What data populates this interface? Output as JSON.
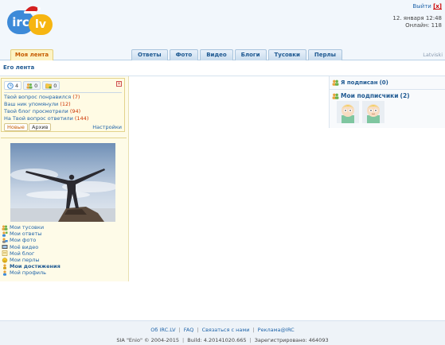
{
  "colors": {
    "brand_blue": "#3d8ad8",
    "brand_orange": "#f6b511",
    "link": "#2266aa",
    "count": "#cc3300",
    "active_tab": "#c65b00"
  },
  "header": {
    "logo_left": "irc",
    "logo_right": "lv",
    "logout_label": "Выйти",
    "logout_x": "[x]",
    "datetime": "12. января 12:48",
    "online": "Онлайн: 118"
  },
  "nav": {
    "my_feed": "Моя лента",
    "tabs": [
      "Ответы",
      "Фото",
      "Видео",
      "Блоги",
      "Тусовки",
      "Перлы"
    ],
    "language": "Latviski"
  },
  "feed": {
    "heading": "Его лента"
  },
  "notifications": {
    "counters": [
      {
        "icon": "clock-icon",
        "value": "4"
      },
      {
        "icon": "users-icon",
        "value": "0"
      },
      {
        "icon": "folder-icon",
        "value": "0"
      }
    ],
    "close": "✕",
    "items": [
      {
        "label": "Твой вопрос понравился",
        "count": "(7)"
      },
      {
        "label": "Ваш ник упомянули",
        "count": "(12)"
      },
      {
        "label": "Твой блог просмотрели",
        "count": "(94)"
      },
      {
        "label": "На Твой вопрос ответили",
        "count": "(144)"
      }
    ],
    "new_label": "Новые",
    "archive_label": "Архив",
    "settings_label": "Настройки"
  },
  "profile_menu": [
    {
      "icon": "group-icon",
      "label": "Мои тусовки"
    },
    {
      "icon": "answers-icon",
      "label": "Мои ответы"
    },
    {
      "icon": "photo-icon",
      "label": "Мои фото"
    },
    {
      "icon": "video-icon",
      "label": "Моё видео"
    },
    {
      "icon": "blog-icon",
      "label": "Мой блог"
    },
    {
      "icon": "smile-icon",
      "label": "Мои перлы"
    },
    {
      "icon": "achievement-icon",
      "label": "Мои достижения"
    },
    {
      "icon": "profile-icon",
      "label": "Мой профиль"
    }
  ],
  "right": {
    "subscribed_label": "Я подписан",
    "subscribed_count": "(0)",
    "followers_label": "Мои подписчики",
    "followers_count": "(2)"
  },
  "footer": {
    "links": [
      "Об IRC.LV",
      "FAQ",
      "Связаться с нами",
      "Реклама@IRC"
    ],
    "copyright": "SIA \"Enio\" © 2004-2015",
    "build": "Build: 4.20141020.665",
    "registered": "Зарегистрировано: 464093"
  }
}
